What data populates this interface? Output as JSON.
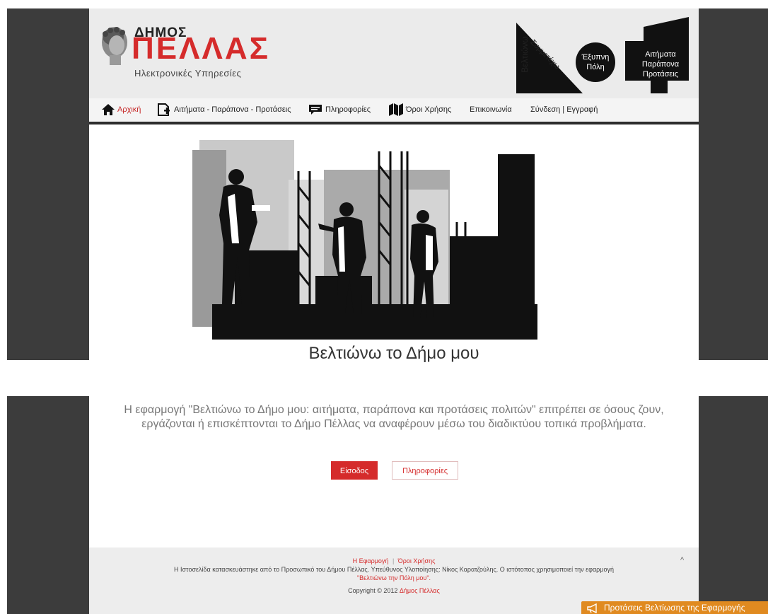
{
  "logo": {
    "dimos": "ΔΗΜΟΣ",
    "pellas": "ΠΕΛΛΑΣ",
    "subtitle": "Ηλεκτρονικές Υπηρεσίες"
  },
  "badges": {
    "veltiono": "Βελτιώνω",
    "symmetexo": "Συμμετέχω",
    "smart_city": [
      "Έξυπνη",
      "Πόλη"
    ],
    "requests": [
      "Αιτήματα",
      "Παράπονα",
      "Προτάσεις"
    ]
  },
  "nav": {
    "items": [
      {
        "label": "Αρχική",
        "icon": "home-icon"
      },
      {
        "label": "Αιτήματα - Παράπονα - Προτάσεις",
        "icon": "add-document-icon"
      },
      {
        "label": "Πληροφορίες",
        "icon": "chat-icon"
      },
      {
        "label": "Όροι Χρήσης",
        "icon": "map-icon"
      },
      {
        "label": "Επικοινωνία"
      },
      {
        "label": "Σύνδεση | Εγγραφή"
      }
    ]
  },
  "hero": {
    "title": "Βελτιώνω το Δήμο μου"
  },
  "intro": {
    "text": "Η εφαρμογή \"Βελτιώνω το Δήμο μου: αιτήματα, παράπονα και προτάσεις πολιτών\" επιτρέπει σε όσους ζουν, εργάζονται ή επισκέπτονται το Δήμο Πέλλας να αναφέρουν μέσω του διαδικτύου τοπικά προβλήματα.",
    "enter_label": "Είσοδος",
    "info_label": "Πληροφορίες"
  },
  "footer": {
    "app_link": "Η Εφαρμογή",
    "separator": "|",
    "terms_link": "Όροι Χρήσης",
    "credits": "Η Ιστοσελίδα κατασκευάστηκε από το Προσωπικό του Δήμου Πέλλας. Υπεύθυνος Υλοποίησης: Νίκος Καρατζούλης. Ο ιστότοπος χρησιμοποιεί την εφαρμογή",
    "app_name": "\"Βελτιώνω την Πόλη μου\".",
    "copyright": "Copyright © 2012",
    "owner_link": "Δήμος Πέλλας",
    "caret": "^"
  },
  "feedback": {
    "label": "Προτάσεις Βελτίωσης της Εφαρμογής",
    "icon": "megaphone-icon"
  },
  "colors": {
    "accent": "#d52b2b",
    "feedback": "#e08a20",
    "sidebar": "#3c3c3c"
  }
}
